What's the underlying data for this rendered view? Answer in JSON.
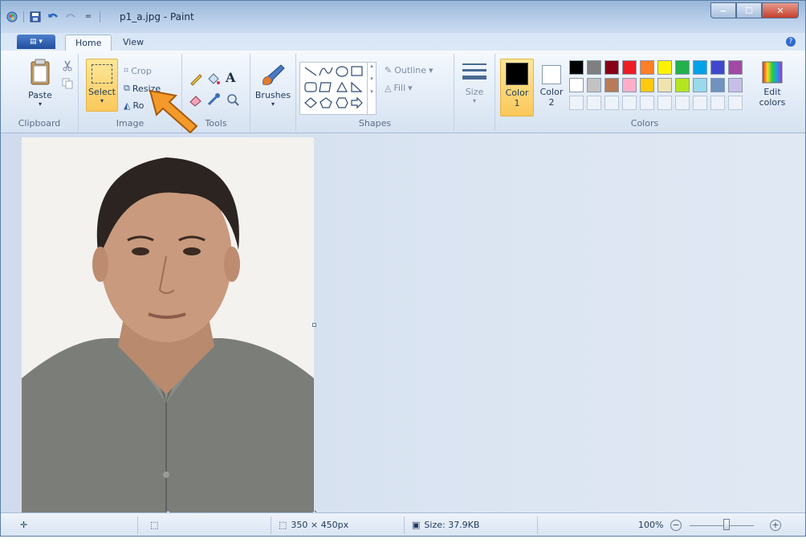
{
  "window": {
    "title": "p1_a.jpg - Paint"
  },
  "tabs": [
    {
      "label": "Home"
    },
    {
      "label": "View"
    }
  ],
  "ribbon": {
    "clipboard": {
      "label": "Clipboard",
      "paste": "Paste"
    },
    "image": {
      "label": "Image",
      "select": "Select",
      "crop": "Crop",
      "resize": "Resize",
      "rotate": "Ro"
    },
    "tools": {
      "label": "Tools"
    },
    "brushes": {
      "label": "Brushes"
    },
    "shapes": {
      "label": "Shapes",
      "outline": "Outline",
      "fill": "Fill"
    },
    "size": {
      "label": "Size"
    },
    "colors": {
      "label": "Colors",
      "color1": "Color\n1",
      "color2": "Color\n2",
      "color1_line1": "Color",
      "color1_line2": "1",
      "color2_line1": "Color",
      "color2_line2": "2",
      "edit_line1": "Edit",
      "edit_line2": "colors",
      "palette_row1": [
        "#000000",
        "#7f7f7f",
        "#880015",
        "#ed1c24",
        "#ff7f27",
        "#fff200",
        "#22b14c",
        "#00a2e8",
        "#3f48cc",
        "#a349a4"
      ],
      "palette_row2": [
        "#ffffff",
        "#c3c3c3",
        "#b97a57",
        "#ffaec9",
        "#ffc90e",
        "#efe4b0",
        "#b5e61d",
        "#99d9ea",
        "#7092be",
        "#c8bfe7"
      ],
      "color1_value": "#000000",
      "color2_value": "#ffffff"
    }
  },
  "status": {
    "dimensions": "350 × 450px",
    "size": "Size: 37.9KB",
    "zoom": "100%"
  }
}
